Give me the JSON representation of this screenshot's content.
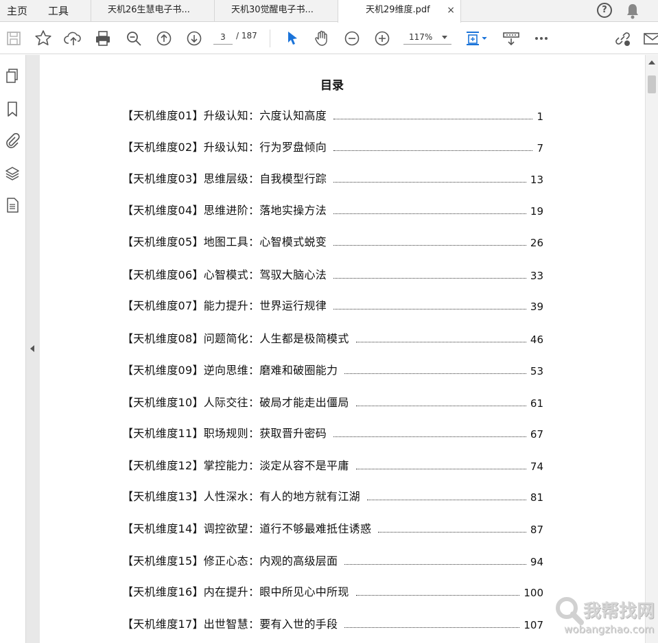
{
  "menu": {
    "home": "主页",
    "tools": "工具"
  },
  "tabs": [
    {
      "label": "天机26生慧电子书...",
      "active": false
    },
    {
      "label": "天机30觉醒电子书...",
      "active": false
    },
    {
      "label": "天机29维度.pdf",
      "active": true,
      "close": "×"
    }
  ],
  "header_icons": {
    "help": "?"
  },
  "toolbar": {
    "page_current": "3",
    "page_total": "/ 187",
    "zoom": "117%"
  },
  "document": {
    "title": "目录",
    "entries": [
      {
        "text": "【天机维度01】升级认知：六度认知高度",
        "page": "1"
      },
      {
        "text": "【天机维度02】升级认知：行为罗盘倾向",
        "page": "7"
      },
      {
        "text": "【天机维度03】思维层级：自我模型行踪",
        "page": "13"
      },
      {
        "text": "【天机维度04】思维进阶：落地实操方法",
        "page": "19"
      },
      {
        "text": "【天机维度05】地图工具：心智模式蜕变",
        "page": "26"
      },
      {
        "text": "【天机维度06】心智模式：驾驭大脑心法",
        "page": "33"
      },
      {
        "text": "【天机维度07】能力提升：世界运行规律",
        "page": "39"
      },
      {
        "text": "【天机维度08】问题简化：人生都是极简模式",
        "page": "46"
      },
      {
        "text": "【天机维度09】逆向思维：磨难和破圈能力",
        "page": "53"
      },
      {
        "text": "【天机维度10】人际交往：破局才能走出僵局",
        "page": "61"
      },
      {
        "text": "【天机维度11】职场规则：获取晋升密码",
        "page": "67"
      },
      {
        "text": "【天机维度12】掌控能力：淡定从容不是平庸",
        "page": "74"
      },
      {
        "text": "【天机维度13】人性深水：有人的地方就有江湖",
        "page": "81"
      },
      {
        "text": "【天机维度14】调控欲望：道行不够最难抵住诱惑",
        "page": "87"
      },
      {
        "text": "【天机维度15】修正心态：内观的高级层面",
        "page": "94"
      },
      {
        "text": "【天机维度16】内在提升：眼中所见心中所现",
        "page": "100"
      },
      {
        "text": "【天机维度17】出世智慧：要有入世的手段",
        "page": "107"
      }
    ]
  },
  "watermark": {
    "main": "我帮找网",
    "sub": "wobangzhao.com"
  },
  "colors": {
    "accent_blue": "#1a73d9",
    "icon_gray": "#555555"
  }
}
